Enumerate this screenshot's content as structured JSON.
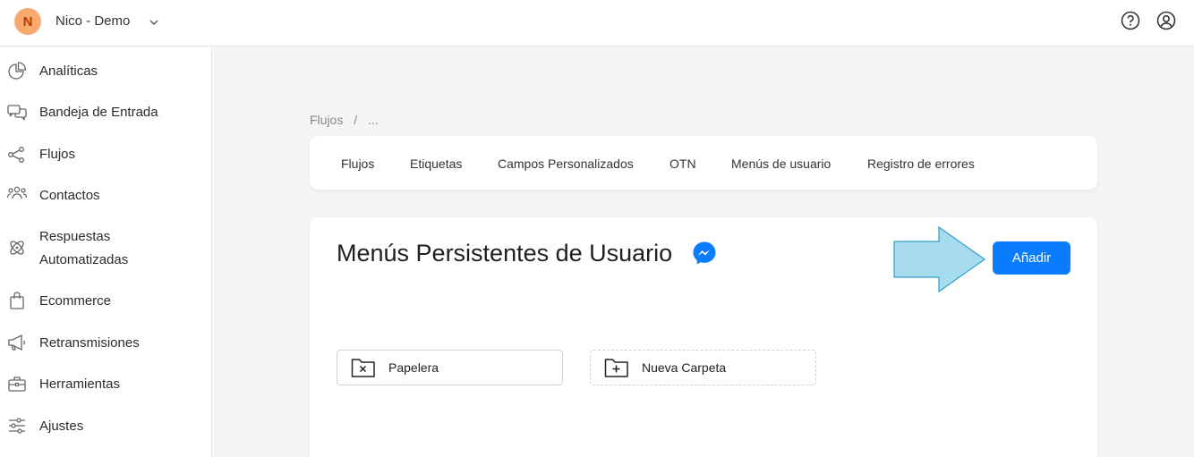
{
  "header": {
    "avatar_letter": "N",
    "workspace_name": "Nico - Demo"
  },
  "sidebar": {
    "items": [
      {
        "label": "Analíticas",
        "icon": "pie-chart-icon"
      },
      {
        "label": "Bandeja de Entrada",
        "icon": "chat-bubbles-icon"
      },
      {
        "label": "Flujos",
        "icon": "flow-icon"
      },
      {
        "label": "Contactos",
        "icon": "users-icon"
      },
      {
        "label": "Respuestas Automatizadas",
        "icon": "atom-icon"
      },
      {
        "label": "Ecommerce",
        "icon": "shopping-bag-icon"
      },
      {
        "label": "Retransmisiones",
        "icon": "megaphone-icon"
      },
      {
        "label": "Herramientas",
        "icon": "toolbox-icon"
      },
      {
        "label": "Ajustes",
        "icon": "sliders-icon"
      }
    ]
  },
  "breadcrumb": {
    "root": "Flujos",
    "separator": "/",
    "current": "..."
  },
  "tabs": [
    {
      "label": "Flujos"
    },
    {
      "label": "Etiquetas"
    },
    {
      "label": "Campos Personalizados"
    },
    {
      "label": "OTN"
    },
    {
      "label": "Menús de usuario"
    },
    {
      "label": "Registro de errores"
    }
  ],
  "main": {
    "title": "Menús Persistentes de Usuario",
    "add_label": "Añadir",
    "folders": [
      {
        "label": "Papelera",
        "icon": "trash-folder-icon"
      },
      {
        "label": "Nueva Carpeta",
        "icon": "new-folder-icon"
      }
    ]
  },
  "colors": {
    "accent": "#0a7cff",
    "avatar_bg": "#f9a96e",
    "arrow_fill": "#a6dcee",
    "arrow_stroke": "#2f9fcc"
  }
}
